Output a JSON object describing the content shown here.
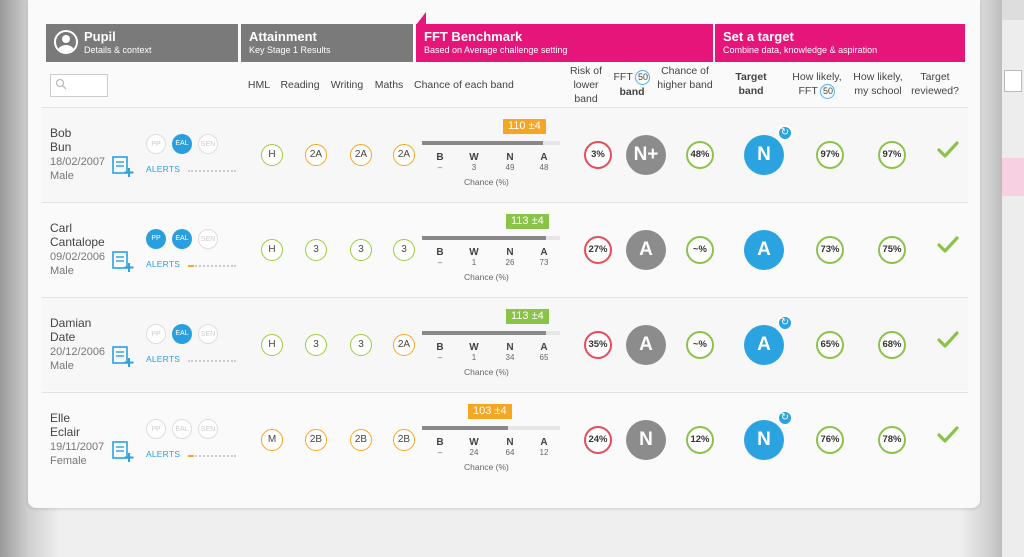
{
  "headers": {
    "pupil": {
      "title": "Pupil",
      "subtitle": "Details & context"
    },
    "attainment": {
      "title": "Attainment",
      "subtitle": "Key Stage 1 Results"
    },
    "fft": {
      "title": "FFT Benchmark",
      "subtitle": "Based on Average challenge setting"
    },
    "target": {
      "title": "Set a target",
      "subtitle": "Combine data, knowledge & aspiration"
    }
  },
  "columns": {
    "hml": "HML",
    "reading": "Reading",
    "writing": "Writing",
    "maths": "Maths",
    "chance": "Chance of each band",
    "risk": "Risk of lower band",
    "fft_band_pre": "FFT",
    "fft_band_num": "50",
    "fft_band_post": "band",
    "higher": "Chance of higher band",
    "target_band": "Target band",
    "likely_fft_pre": "How likely,",
    "likely_fft_mid": "FFT",
    "likely_fft_num": "50",
    "likely_school": "How likely, my school",
    "reviewed": "Target reviewed?"
  },
  "flags": {
    "pp": "PP",
    "eal": "EAL",
    "sen": "SEN"
  },
  "alerts_label": "ALERTS",
  "bands": {
    "b": "B",
    "w": "W",
    "n": "N",
    "a": "A",
    "chance": "Chance (%)"
  },
  "colors": {
    "pink": "#e6157a",
    "gray": "#7a7a7a",
    "blue": "#2aa3e0",
    "green": "#8bc34a",
    "amber": "#f5a623",
    "red": "#e74c5a"
  },
  "pupils": [
    {
      "first": "Bob",
      "last": "Bun",
      "dob": "18/02/2007",
      "gender": "Male",
      "pp": false,
      "eal": true,
      "sen": false,
      "alert_level": 0,
      "hml": "H",
      "reading": "2A",
      "writing": "2A",
      "maths": "2A",
      "hml_c": "green",
      "reading_c": "amber",
      "writing_c": "amber",
      "maths_c": "amber",
      "estimate": "110 ±4",
      "estimate_c": "amber",
      "bench_fill": 0.88,
      "chance": {
        "b": "–",
        "w": "3",
        "n": "49",
        "a": "48"
      },
      "risk": "3%",
      "fft_band": "N+",
      "higher": "48%",
      "target": "N",
      "likely_fft": "97%",
      "likely_school": "97%",
      "reviewed": true,
      "rev_icon": true
    },
    {
      "first": "Carl",
      "last": "Cantalope",
      "dob": "09/02/2006",
      "gender": "Male",
      "pp": true,
      "eal": true,
      "sen": false,
      "alert_level": 0.12,
      "hml": "H",
      "reading": "3",
      "writing": "3",
      "maths": "3",
      "hml_c": "green",
      "reading_c": "green",
      "writing_c": "green",
      "maths_c": "green",
      "estimate": "113 ±4",
      "estimate_c": "green",
      "bench_fill": 0.9,
      "chance": {
        "b": "–",
        "w": "1",
        "n": "26",
        "a": "73"
      },
      "risk": "27%",
      "fft_band": "A",
      "higher": "~%",
      "target": "A",
      "likely_fft": "73%",
      "likely_school": "75%",
      "reviewed": true,
      "rev_icon": false
    },
    {
      "first": "Damian",
      "last": "Date",
      "dob": "20/12/2006",
      "gender": "Male",
      "pp": false,
      "eal": true,
      "sen": false,
      "alert_level": 0,
      "hml": "H",
      "reading": "3",
      "writing": "3",
      "maths": "2A",
      "hml_c": "green",
      "reading_c": "green",
      "writing_c": "green",
      "maths_c": "amber",
      "estimate": "113 ±4",
      "estimate_c": "green",
      "bench_fill": 0.9,
      "chance": {
        "b": "–",
        "w": "1",
        "n": "34",
        "a": "65"
      },
      "risk": "35%",
      "fft_band": "A",
      "higher": "~%",
      "target": "A",
      "likely_fft": "65%",
      "likely_school": "68%",
      "reviewed": true,
      "rev_icon": true
    },
    {
      "first": "Elle",
      "last": "Eclair",
      "dob": "19/11/2007",
      "gender": "Female",
      "pp": false,
      "eal": false,
      "sen": false,
      "alert_level": 0.12,
      "hml": "M",
      "reading": "2B",
      "writing": "2B",
      "maths": "2B",
      "hml_c": "amber",
      "reading_c": "amber",
      "writing_c": "amber",
      "maths_c": "amber",
      "estimate": "103 ±4",
      "estimate_c": "amber",
      "bench_fill": 0.62,
      "chance": {
        "b": "–",
        "w": "24",
        "n": "64",
        "a": "12"
      },
      "risk": "24%",
      "fft_band": "N",
      "higher": "12%",
      "target": "N",
      "likely_fft": "76%",
      "likely_school": "78%",
      "reviewed": true,
      "rev_icon": true
    }
  ]
}
